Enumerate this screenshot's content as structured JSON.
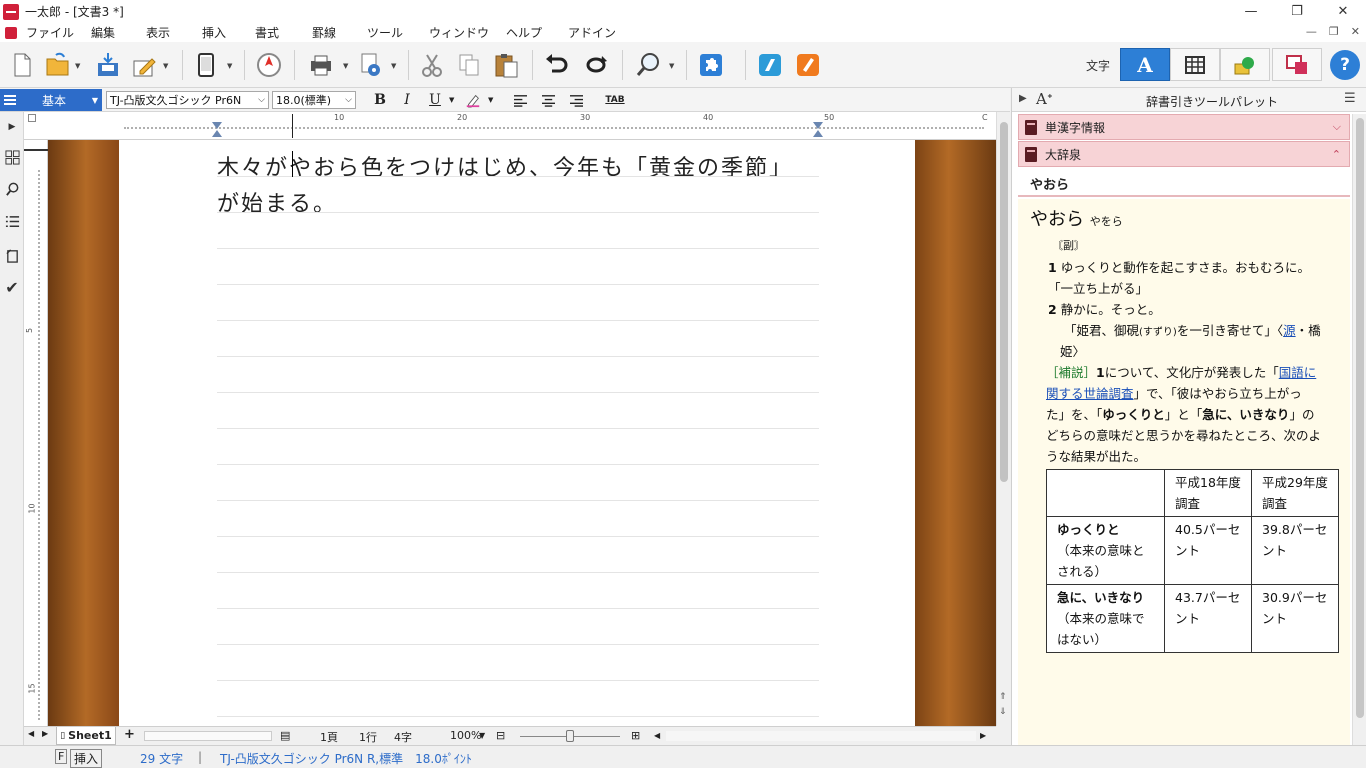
{
  "window": {
    "title": "一太郎 - [文書3 *]",
    "minimize": "—",
    "restore": "❐",
    "close": "✕"
  },
  "menu": {
    "items": [
      "ファイル",
      "編集",
      "表示",
      "挿入",
      "書式",
      "罫線",
      "ツール",
      "ウィンドウ",
      "ヘルプ",
      "アドイン"
    ]
  },
  "toolbar": {
    "moji_label": "文字",
    "mode_text": "A",
    "help": "?"
  },
  "format": {
    "style": "基本",
    "font": "TJ-凸版文久ゴシック Pr6N",
    "size": "18.0(標準)",
    "bold": "B",
    "italic": "I",
    "underline": "U",
    "tab": "TAB"
  },
  "ruler": {
    "h_numbers": [
      "10",
      "20",
      "30",
      "40",
      "50"
    ],
    "h_end": "C",
    "v_numbers": [
      "5",
      "10",
      "15"
    ]
  },
  "document": {
    "lines": [
      "木々がやおら色をつけはじめ、今年も「黄金の季節」",
      "が始まる。"
    ]
  },
  "sheetbar": {
    "tab": "Sheet1",
    "add": "+",
    "page": "1頁",
    "row": "1行",
    "chars": "4字",
    "zoom": "100%"
  },
  "status": {
    "mode_key": "F",
    "mode": "挿入",
    "char_count": "29 文字",
    "font_info": "TJ-凸版文久ゴシック Pr6N R,標準　18.0ﾎﾟｲﾝﾄ"
  },
  "panel": {
    "title": "辞書引きツールパレット",
    "section1": "単漢字情報",
    "section2": "大辞泉",
    "headword_bar": "やおら",
    "entry": {
      "headword": "やおら",
      "reading": "やをら",
      "pos": "〘副〙",
      "sense1_num": "1",
      "sense1": "ゆっくりと動作を起こすさま。おもむろに。",
      "sense1_ex": "「一立ち上がる」",
      "sense2_num": "2",
      "sense2": "静かに。そっと。",
      "sense2_ex_a": "「姫君、御硯",
      "sense2_ex_ruby": "(すずり)",
      "sense2_ex_b": "を一引き寄せて」〈",
      "sense2_link": "源",
      "sense2_ex_c": "・橋",
      "sense2_ex_d": "姫〉",
      "note_label": "［補説］",
      "note_num": "1",
      "note_a": "について、文化庁が発表した「",
      "note_link_a": "国語に",
      "note_link_b": "関する世論調査",
      "note_b": "」で、「彼はやおら立ち上がっ",
      "note_c": "た」を、「",
      "note_bold1": "ゆっくりと",
      "note_d": "」と「",
      "note_bold2": "急に、いきなり",
      "note_e": "」の",
      "note_f": "どちらの意味だと思うかを尋ねたところ、次のよ",
      "note_g": "うな結果が出た。"
    },
    "table": {
      "header": [
        "",
        "平成18年度調査",
        "平成29年度調査"
      ],
      "rows": [
        {
          "label": "ゆっくりと",
          "sub": "（本来の意味とされる）",
          "v1": "40.5パーセント",
          "v2": "39.8パーセント"
        },
        {
          "label": "急に、いきなり",
          "sub": "（本来の意味ではない）",
          "v1": "43.7パーセント",
          "v2": "30.9パーセント"
        }
      ]
    }
  },
  "colors": {
    "accent": "#2d7fd6",
    "panel_section": "#f7d3d6",
    "dict_bg": "#fffbea",
    "wood": "#b36a26"
  }
}
